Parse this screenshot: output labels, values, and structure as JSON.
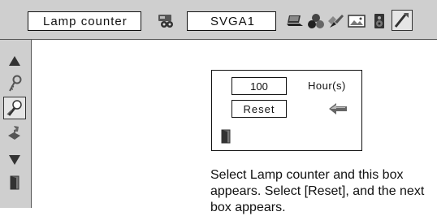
{
  "menubar": {
    "title": "Lamp counter",
    "input_label": "SVGA1"
  },
  "dialog": {
    "hours_value": "100",
    "hours_unit": "Hour(s)",
    "reset_label": "Reset"
  },
  "description": "Select Lamp counter and this box appears. Select [Reset], and the next box appears.",
  "icons": {
    "top": [
      "input-icon",
      "pc-adjust-icon",
      "image-icon",
      "screen-adjust-icon",
      "picture-icon",
      "sound-icon",
      "setting-icon"
    ],
    "sidebar": [
      "up-arrow-icon",
      "key-icon",
      "lamp-setting-icon",
      "help-icon",
      "down-arrow-icon",
      "exit-icon"
    ]
  }
}
